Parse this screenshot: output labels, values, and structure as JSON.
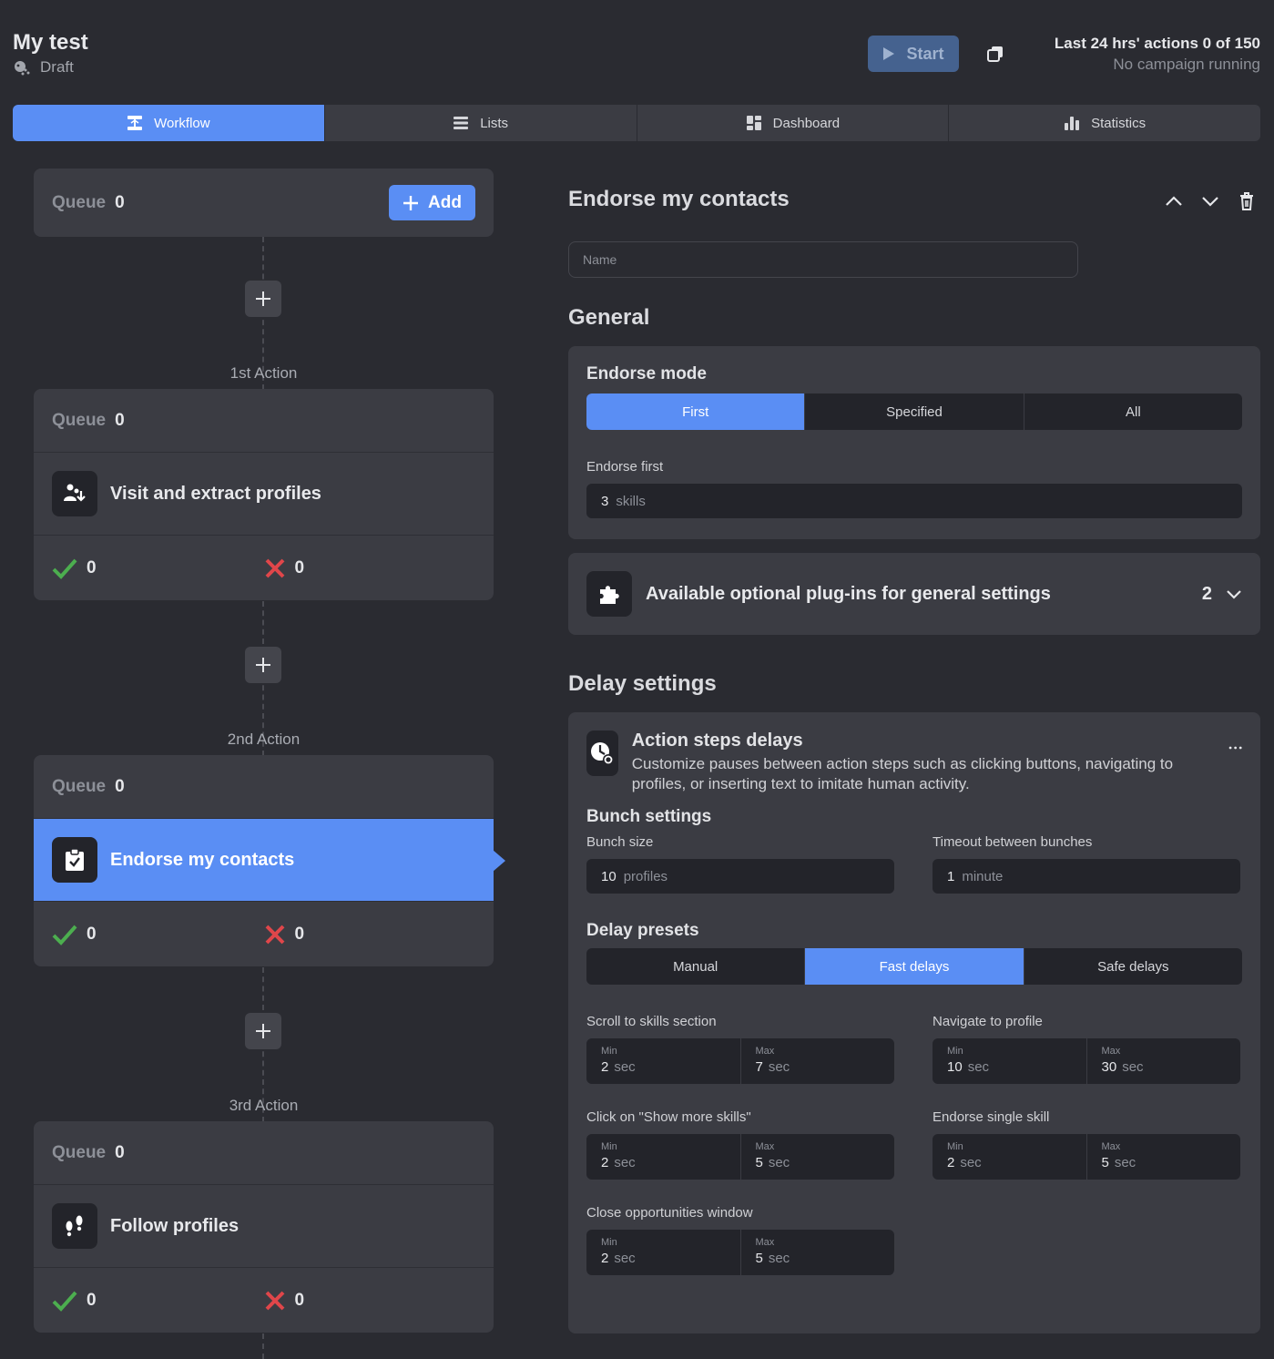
{
  "header": {
    "title": "My test",
    "status": "Draft",
    "start_label": "Start",
    "quota_line": "Last 24 hrs' actions 0 of 150",
    "campaign_status": "No campaign running"
  },
  "tabs": [
    {
      "label": "Workflow",
      "active": true
    },
    {
      "label": "Lists",
      "active": false
    },
    {
      "label": "Dashboard",
      "active": false
    },
    {
      "label": "Statistics",
      "active": false
    }
  ],
  "workflow": {
    "queue_label": "Queue",
    "initial_queue": "0",
    "add_label": "Add",
    "actions": [
      {
        "step_label": "1st Action",
        "queue": "0",
        "name": "Visit and extract profiles",
        "success": "0",
        "fail": "0"
      },
      {
        "step_label": "2nd Action",
        "queue": "0",
        "name": "Endorse my contacts",
        "success": "0",
        "fail": "0"
      },
      {
        "step_label": "3rd Action",
        "queue": "0",
        "name": "Follow profiles",
        "success": "0",
        "fail": "0"
      }
    ]
  },
  "detail": {
    "title": "Endorse my contacts",
    "name_placeholder": "Name",
    "general_heading": "General",
    "endorse_mode_heading": "Endorse mode",
    "endorse_modes": [
      "First",
      "Specified",
      "All"
    ],
    "endorse_first_label": "Endorse first",
    "endorse_first_value": "3",
    "endorse_first_unit": "skills",
    "plugins_label": "Available optional plug-ins for general settings",
    "plugins_count": "2",
    "delay_heading": "Delay settings",
    "action_delays_title": "Action steps delays",
    "action_delays_desc": "Customize pauses between action steps such as clicking buttons, navigating to profiles, or inserting text to imitate human activity.",
    "bunch_heading": "Bunch settings",
    "bunch_size_label": "Bunch size",
    "bunch_size_value": "10",
    "bunch_size_unit": "profiles",
    "timeout_label": "Timeout between bunches",
    "timeout_value": "1",
    "timeout_unit": "minute",
    "presets_heading": "Delay presets",
    "presets": [
      "Manual",
      "Fast delays",
      "Safe delays"
    ],
    "min_label": "Min",
    "max_label": "Max",
    "sec_unit": "sec",
    "delays": [
      {
        "label": "Scroll to skills section",
        "min": "2",
        "max": "7"
      },
      {
        "label": "Navigate to profile",
        "min": "10",
        "max": "30"
      },
      {
        "label": "Click on \"Show more skills\"",
        "min": "2",
        "max": "5"
      },
      {
        "label": "Endorse single skill",
        "min": "2",
        "max": "5"
      },
      {
        "label": "Close opportunities window",
        "min": "2",
        "max": "5"
      }
    ]
  }
}
